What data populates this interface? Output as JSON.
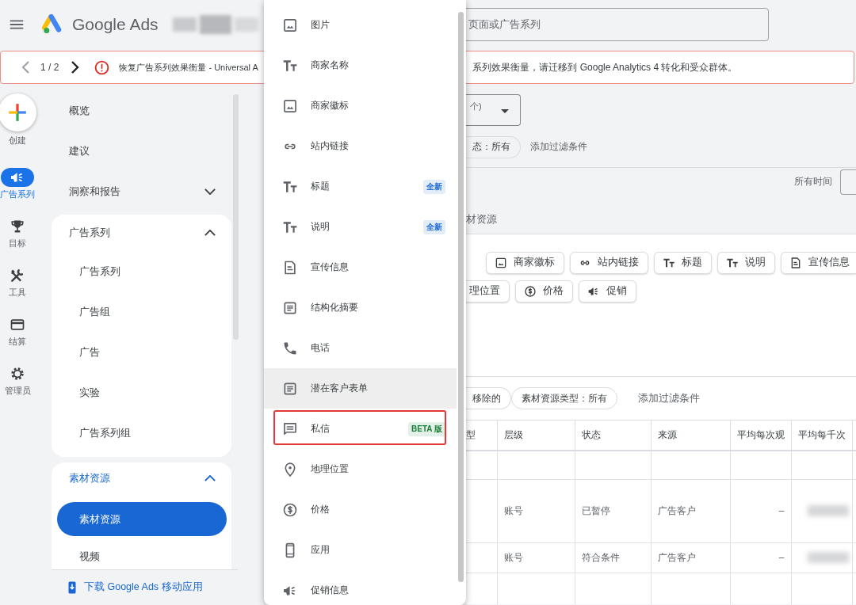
{
  "top_bar": {
    "product_name": "Google Ads",
    "search": {
      "placeholder": "页面或广告系列"
    }
  },
  "banner": {
    "counter": "1 / 2",
    "message_start": "恢复广告系列效果衡量 - Universal A",
    "message_end": "系列效果衡量，请迁移到 Google Analytics 4 转化和受众群体。"
  },
  "rail": {
    "create_label": "创建",
    "items": [
      {
        "label": "广告系列",
        "selected": true
      },
      {
        "label": "目标",
        "selected": false
      },
      {
        "label": "工具",
        "selected": false
      },
      {
        "label": "结算",
        "selected": false
      },
      {
        "label": "管理员",
        "selected": false
      }
    ]
  },
  "nav": {
    "items": [
      {
        "label": "概览"
      },
      {
        "label": "建议"
      },
      {
        "label": "洞察和报告",
        "expanded": false
      }
    ],
    "sections": [
      {
        "title": "广告系列",
        "expanded": true,
        "selected": false,
        "items": [
          {
            "label": "广告系列",
            "selected": false
          },
          {
            "label": "广告组",
            "selected": false
          },
          {
            "label": "广告",
            "selected": false
          },
          {
            "label": "实验",
            "selected": false
          },
          {
            "label": "广告系列组",
            "selected": false
          }
        ]
      },
      {
        "title": "素材资源",
        "expanded": true,
        "selected": true,
        "items": [
          {
            "label": "素材资源",
            "selected": true
          },
          {
            "label": "视频",
            "selected": false
          }
        ]
      }
    ],
    "download_link": "下载 Google Ads 移动应用"
  },
  "main": {
    "view_select": {
      "value": "个)"
    },
    "filters": [
      {
        "kind": "chip",
        "label": "态：所有"
      },
      {
        "kind": "link",
        "label": "添加过滤条件"
      }
    ],
    "date_range": {
      "label": "所有时间"
    },
    "tab": "材资源",
    "asset_type_chip_rows": [
      [
        "商家徽标",
        "站内链接",
        "标题",
        "说明",
        "宣传信息"
      ],
      [
        "理位置",
        "价格",
        "促销"
      ]
    ],
    "table_filters": [
      {
        "kind": "chip",
        "label": "移除的"
      },
      {
        "kind": "chip",
        "label": "素材资源类型：所有"
      },
      {
        "kind": "link",
        "label": "添加过滤条件"
      }
    ],
    "table": {
      "columns": [
        "型",
        "层级",
        "状态",
        "来源",
        "平均每次观",
        "平均每千次"
      ],
      "rows": [
        {
          "column_2": "账号",
          "column_3": "已暂停",
          "column_4": "广告客户",
          "column_5": "–"
        },
        {
          "column_2": "账号",
          "column_3": "符合条件",
          "column_4": "广告客户",
          "column_5": "–"
        }
      ]
    }
  },
  "menu": {
    "items": [
      {
        "label": "图片",
        "hovered": false,
        "highlighted": false
      },
      {
        "label": "商家名称",
        "hovered": false,
        "highlighted": false
      },
      {
        "label": "商家徽标",
        "hovered": false,
        "highlighted": false
      },
      {
        "label": "站内链接",
        "hovered": false,
        "highlighted": false
      },
      {
        "label": "标题",
        "badge": {
          "text": "全新",
          "color": "#1967d2"
        },
        "hovered": false,
        "highlighted": false
      },
      {
        "label": "说明",
        "badge": {
          "text": "全新",
          "color": "#1967d2"
        },
        "hovered": false,
        "highlighted": false
      },
      {
        "label": "宣传信息",
        "hovered": false,
        "highlighted": false
      },
      {
        "label": "结构化摘要",
        "hovered": false,
        "highlighted": false
      },
      {
        "label": "电话",
        "hovered": false,
        "highlighted": false
      },
      {
        "label": "潜在客户表单",
        "hovered": true,
        "highlighted": false
      },
      {
        "label": "私信",
        "badge": {
          "text": "BETA 版",
          "color": "#188038"
        },
        "hovered": false,
        "highlighted": true
      },
      {
        "label": "地理位置",
        "hovered": false,
        "highlighted": false
      },
      {
        "label": "价格",
        "hovered": false,
        "highlighted": false
      },
      {
        "label": "应用",
        "hovered": false,
        "highlighted": false
      },
      {
        "label": "促销信息",
        "hovered": false,
        "highlighted": false
      }
    ]
  }
}
